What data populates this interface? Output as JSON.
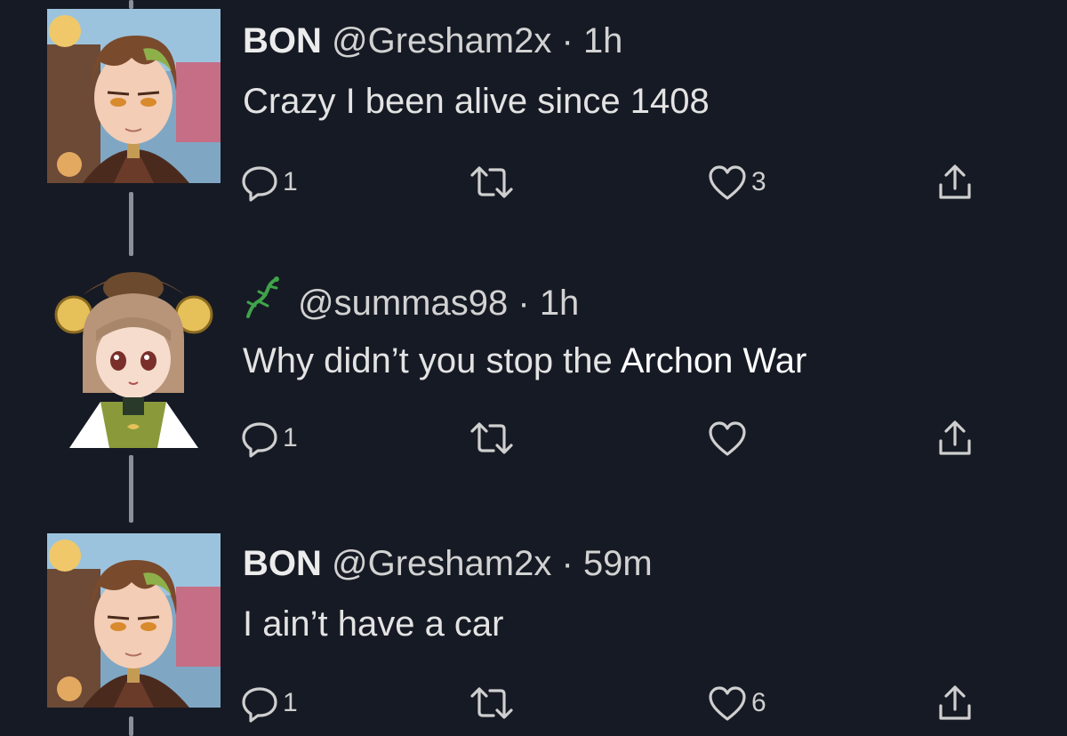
{
  "tweets": [
    {
      "display_name": "BON",
      "handle": "@Gresham2x",
      "separator": "·",
      "time": "1h",
      "text": "Crazy I been alive since 1408",
      "replies": "1",
      "retweets": "",
      "likes": "3",
      "avatar": "avatar-bon"
    },
    {
      "display_name": "",
      "handle": "@summas98",
      "separator": "·",
      "time": "1h",
      "text": "Why didn’t you stop the ",
      "overlay_text": "Archon War",
      "replies": "1",
      "retweets": "",
      "likes": "",
      "avatar": "avatar-summas",
      "name_icon": "lizard-icon"
    },
    {
      "display_name": "BON",
      "handle": "@Gresham2x",
      "separator": "·",
      "time": "59m",
      "text": "I ain’t have a car",
      "replies": "1",
      "retweets": "",
      "likes": "6",
      "avatar": "avatar-bon"
    }
  ],
  "icons": {
    "reply": "reply-icon",
    "retweet": "retweet-icon",
    "like": "heart-icon",
    "share": "share-icon"
  },
  "colors": {
    "background": "#161a24",
    "text": "#e3e3e3",
    "thread_line": "#8a8f99"
  }
}
